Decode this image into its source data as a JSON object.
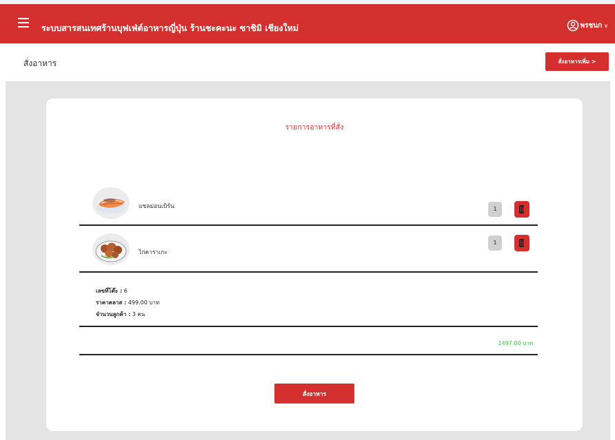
{
  "header": {
    "title": "ระบบสารสนเทศร้านบุฟเฟ่ต์อาหารญี่ปุ่น ร้านชะคะนะ ซาชิมิ เชียงใหม่",
    "user_name": "พรชนก",
    "chevron": "∨",
    "icons": {
      "menu": "menu-icon",
      "user": "user-icon"
    },
    "colors": {
      "brand": "#d32f2f"
    }
  },
  "subheader": {
    "title": "สั่งอาหาร",
    "order_more_label": "สั่งอาหารเพิ่ม >"
  },
  "card": {
    "title": "รายการอาหารที่สั่ง",
    "items": [
      {
        "name": "แซลม่อนเบิร์น",
        "quantity": "1",
        "image": "salmon-image"
      },
      {
        "name": "ไก่คาราเกะ",
        "quantity": "1",
        "image": "karaage-image"
      }
    ],
    "info": {
      "table_label": "เลขที่โต๊ะ :",
      "table_value": "6",
      "class_price_label": "ราคาคลาส :",
      "class_price_value": "499.00 บาท",
      "customers_label": "จำนวนลูกค้า :",
      "customers_value": "3 คน"
    },
    "total": "1497.00 บาท",
    "order_button_label": "สั่งอาหาร",
    "colors": {
      "total": "#2ecc40",
      "delete": "#d32f2f"
    }
  }
}
